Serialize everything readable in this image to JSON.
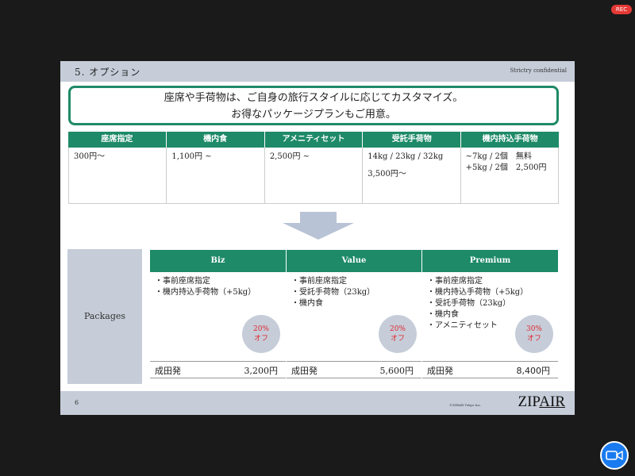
{
  "app": {
    "rec_label": "REC"
  },
  "slide": {
    "section_title": "5. オプション",
    "confidential": "Strictry confidential",
    "callout": {
      "line1": "座席や手荷物は、ご自身の旅行スタイルに応じてカスタマイズ。",
      "line2": "お得なパッケージプランもご用意。"
    },
    "options": {
      "headers": [
        "座席指定",
        "機内食",
        "アメニティセット",
        "受託手荷物",
        "機内持込手荷物"
      ],
      "cells": [
        [
          "300円〜"
        ],
        [
          "1,100円 ~"
        ],
        [
          "2,500円 ~"
        ],
        [
          "14kg / 23kg / 32kg",
          "3,500円〜"
        ],
        [
          "~7kg / 2個　無料",
          "+5kg / 2個　2,500円"
        ]
      ]
    },
    "packages": {
      "label": "Packages",
      "columns": [
        {
          "name": "Biz",
          "items": [
            "・事前座席指定",
            "・機内持込手荷物（+5kg）"
          ],
          "discount": [
            "20%",
            "オフ"
          ],
          "departure": "成田発",
          "price": "3,200円"
        },
        {
          "name": "Value",
          "items": [
            "・事前座席指定",
            "・受託手荷物（23kg）",
            "・機内食"
          ],
          "discount": [
            "20%",
            "オフ"
          ],
          "departure": "成田発",
          "price": "5,600円"
        },
        {
          "name": "Premium",
          "items": [
            "・事前座席指定",
            "・機内持込手荷物（+5kg）",
            "・受託手荷物（23kg）",
            "・機内食",
            "・アメニティセット"
          ],
          "discount": [
            "30%",
            "オフ"
          ],
          "departure": "成田発",
          "price": "8,400円"
        }
      ]
    },
    "footer": {
      "page_number": "6",
      "copyright": "©ZIPAIR Tokyo Inc.",
      "logo": {
        "part1": "ZIP",
        "part2": "AIR"
      }
    }
  },
  "colors": {
    "accent_green": "#1e8a67",
    "header_gray": "#c6cdd9",
    "discount_red": "#e0282e",
    "rec_red": "#e53935",
    "zoom_blue": "#1a7bf0"
  },
  "icons": {
    "arrow": "down-arrow-icon",
    "camera": "video-camera-icon"
  }
}
